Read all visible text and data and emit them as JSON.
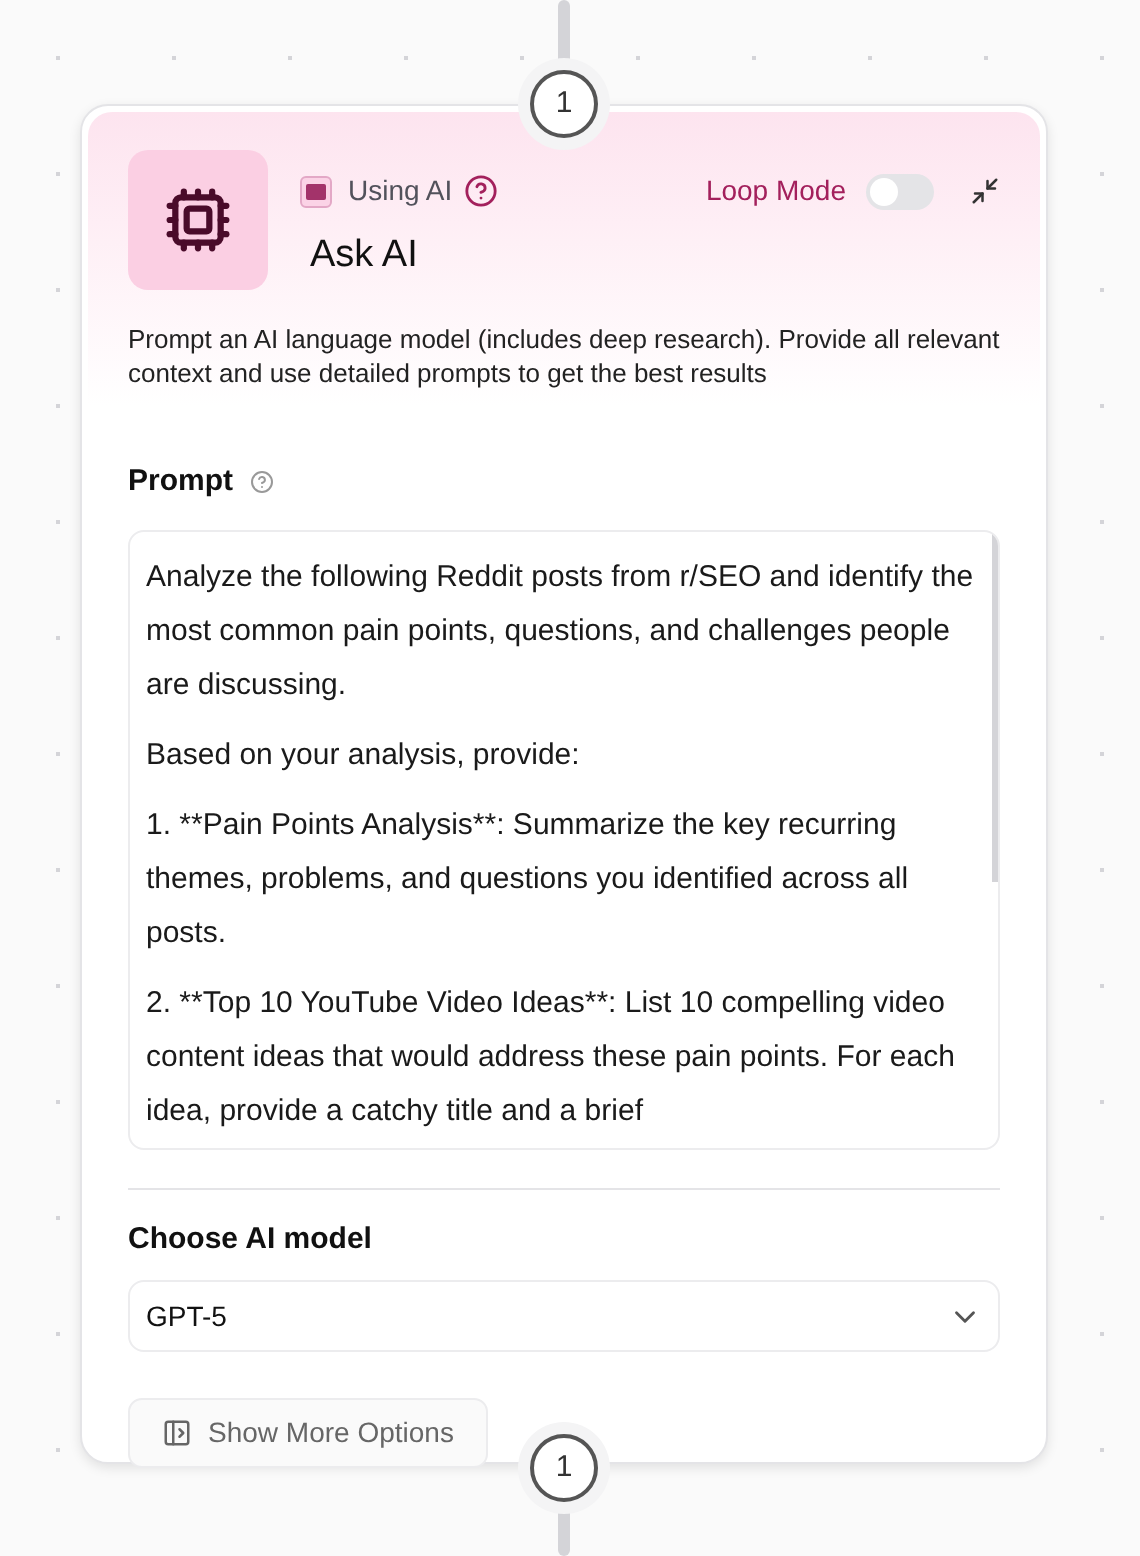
{
  "top_port": {
    "label": "1"
  },
  "header": {
    "badge": "Using AI",
    "title": "Ask AI",
    "loop_mode": {
      "label": "Loop Mode",
      "on": false
    }
  },
  "description": "Prompt an AI language model (includes deep research). Provide all relevant context and use detailed prompts to get the best results",
  "prompt": {
    "label": "Prompt",
    "paragraphs": [
      "Analyze the following Reddit posts from r/SEO and identify the most common pain points, questions, and challenges people are discussing.",
      "Based on your analysis, provide:",
      "1. **Pain Points Analysis**: Summarize the key recurring themes, problems, and questions you identified across all posts.",
      "2. **Top 10 YouTube Video Ideas**: List 10 compelling video content ideas that would address these pain points. For each idea, provide a catchy title and a brief"
    ]
  },
  "model": {
    "label": "Choose AI model",
    "value": "GPT-5"
  },
  "more_options": {
    "label": "Show More Options"
  },
  "bottom_port": {
    "label": "1"
  }
}
